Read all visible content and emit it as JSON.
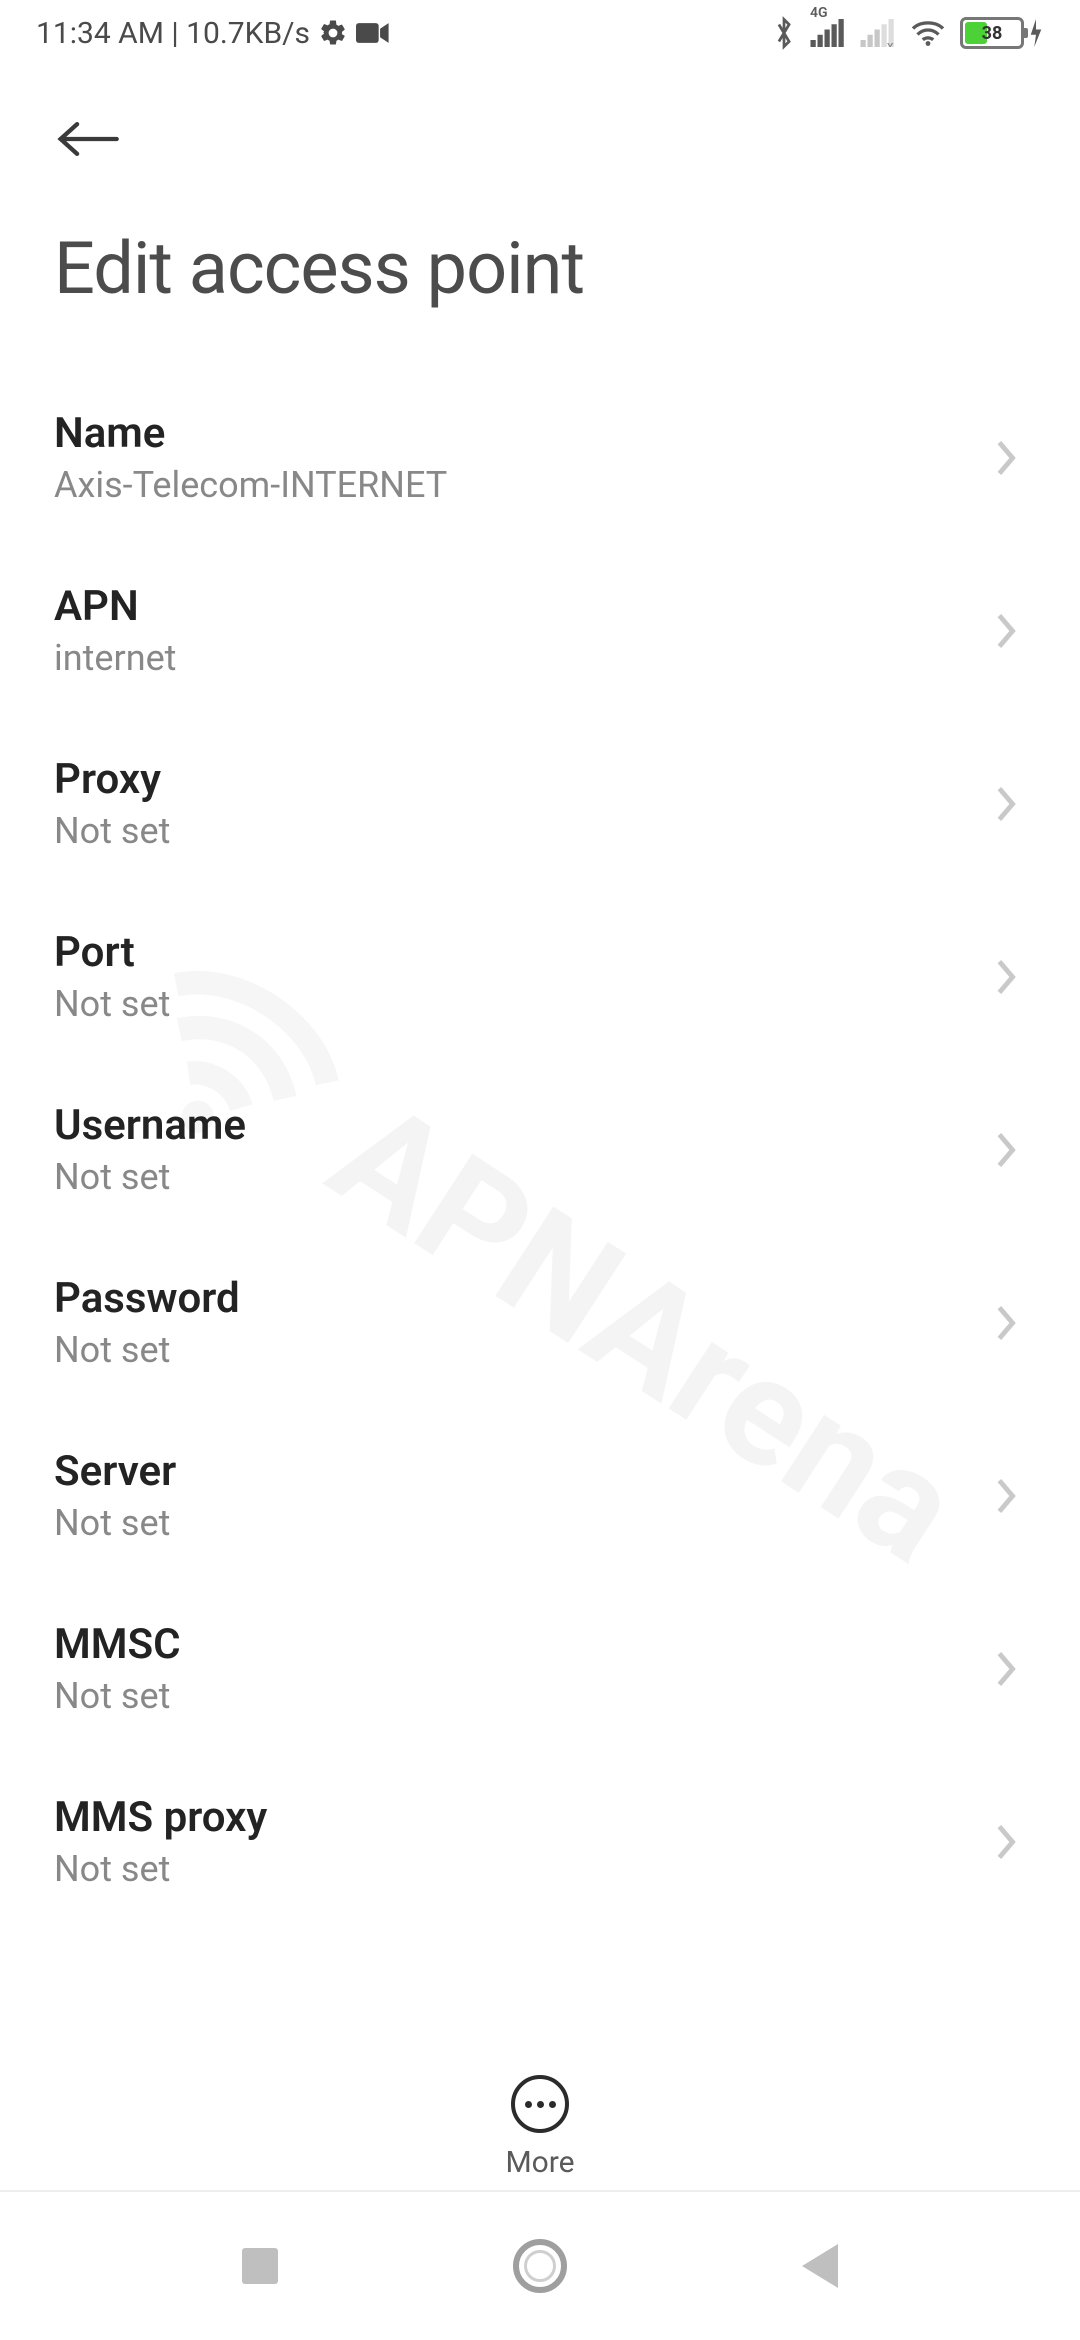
{
  "status_bar": {
    "time": "11:34 AM",
    "separator": " | ",
    "data_rate": "10.7KB/s",
    "network_type": "4G",
    "battery_percent": "38"
  },
  "header": {
    "title": "Edit access point"
  },
  "settings": [
    {
      "label": "Name",
      "value": "Axis-Telecom-INTERNET"
    },
    {
      "label": "APN",
      "value": "internet"
    },
    {
      "label": "Proxy",
      "value": "Not set"
    },
    {
      "label": "Port",
      "value": "Not set"
    },
    {
      "label": "Username",
      "value": "Not set"
    },
    {
      "label": "Password",
      "value": "Not set"
    },
    {
      "label": "Server",
      "value": "Not set"
    },
    {
      "label": "MMSC",
      "value": "Not set"
    },
    {
      "label": "MMS proxy",
      "value": "Not set"
    }
  ],
  "bottom_action": {
    "label": "More"
  },
  "watermark": "APNArena"
}
